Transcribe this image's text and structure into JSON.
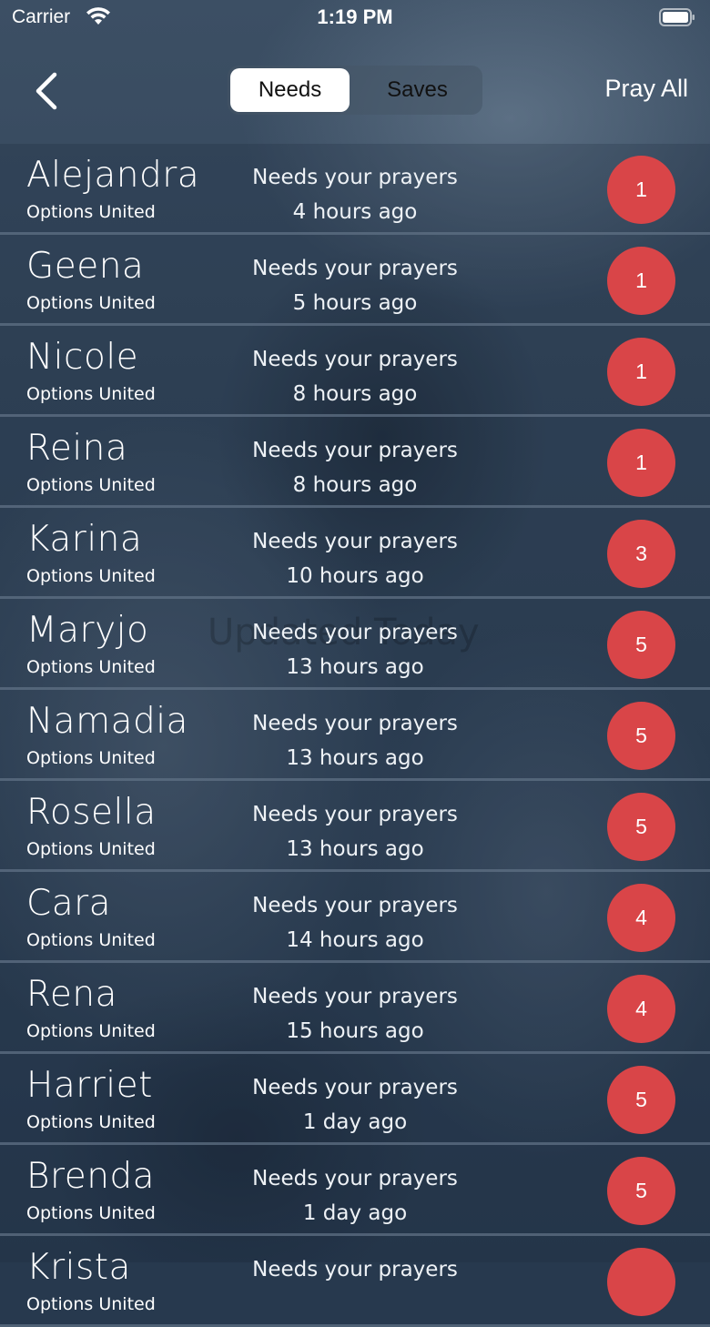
{
  "status_bar": {
    "carrier": "Carrier",
    "time": "1:19 PM",
    "wifi_icon": "wifi-icon",
    "battery_icon": "battery-icon"
  },
  "navbar": {
    "back_icon": "chevron-left-icon",
    "tabs": [
      {
        "label": "Needs",
        "selected": true
      },
      {
        "label": "Saves",
        "selected": false
      }
    ],
    "pray_all_label": "Pray All"
  },
  "background_overlay_text": "Updated Today",
  "colors": {
    "badge": "#d94548",
    "background": "#2c3f55",
    "row_divider": "#5f7084"
  },
  "items": [
    {
      "name": "Alejandra",
      "org": "Options United",
      "message": "Needs your prayers",
      "time": "4 hours ago",
      "count": "1"
    },
    {
      "name": "Geena",
      "org": "Options United",
      "message": "Needs your prayers",
      "time": "5 hours ago",
      "count": "1"
    },
    {
      "name": "Nicole",
      "org": "Options United",
      "message": "Needs your prayers",
      "time": "8 hours ago",
      "count": "1"
    },
    {
      "name": "Reina",
      "org": "Options United",
      "message": "Needs your prayers",
      "time": "8 hours ago",
      "count": "1"
    },
    {
      "name": "Karina",
      "org": "Options United",
      "message": "Needs your prayers",
      "time": "10 hours ago",
      "count": "3"
    },
    {
      "name": "Maryjo",
      "org": "Options United",
      "message": "Needs your prayers",
      "time": "13 hours ago",
      "count": "5"
    },
    {
      "name": "Namadia",
      "org": "Options United",
      "message": "Needs your prayers",
      "time": "13 hours ago",
      "count": "5"
    },
    {
      "name": "Rosella",
      "org": "Options United",
      "message": "Needs your prayers",
      "time": "13 hours ago",
      "count": "5"
    },
    {
      "name": "Cara",
      "org": "Options United",
      "message": "Needs your prayers",
      "time": "14 hours ago",
      "count": "4"
    },
    {
      "name": "Rena",
      "org": "Options United",
      "message": "Needs your prayers",
      "time": "15 hours ago",
      "count": "4"
    },
    {
      "name": "Harriet",
      "org": "Options United",
      "message": "Needs your prayers",
      "time": "1 day ago",
      "count": "5"
    },
    {
      "name": "Brenda",
      "org": "Options United",
      "message": "Needs your prayers",
      "time": "1 day ago",
      "count": "5"
    },
    {
      "name": "Krista",
      "org": "Options United",
      "message": "Needs your prayers",
      "time": "",
      "count": ""
    }
  ]
}
